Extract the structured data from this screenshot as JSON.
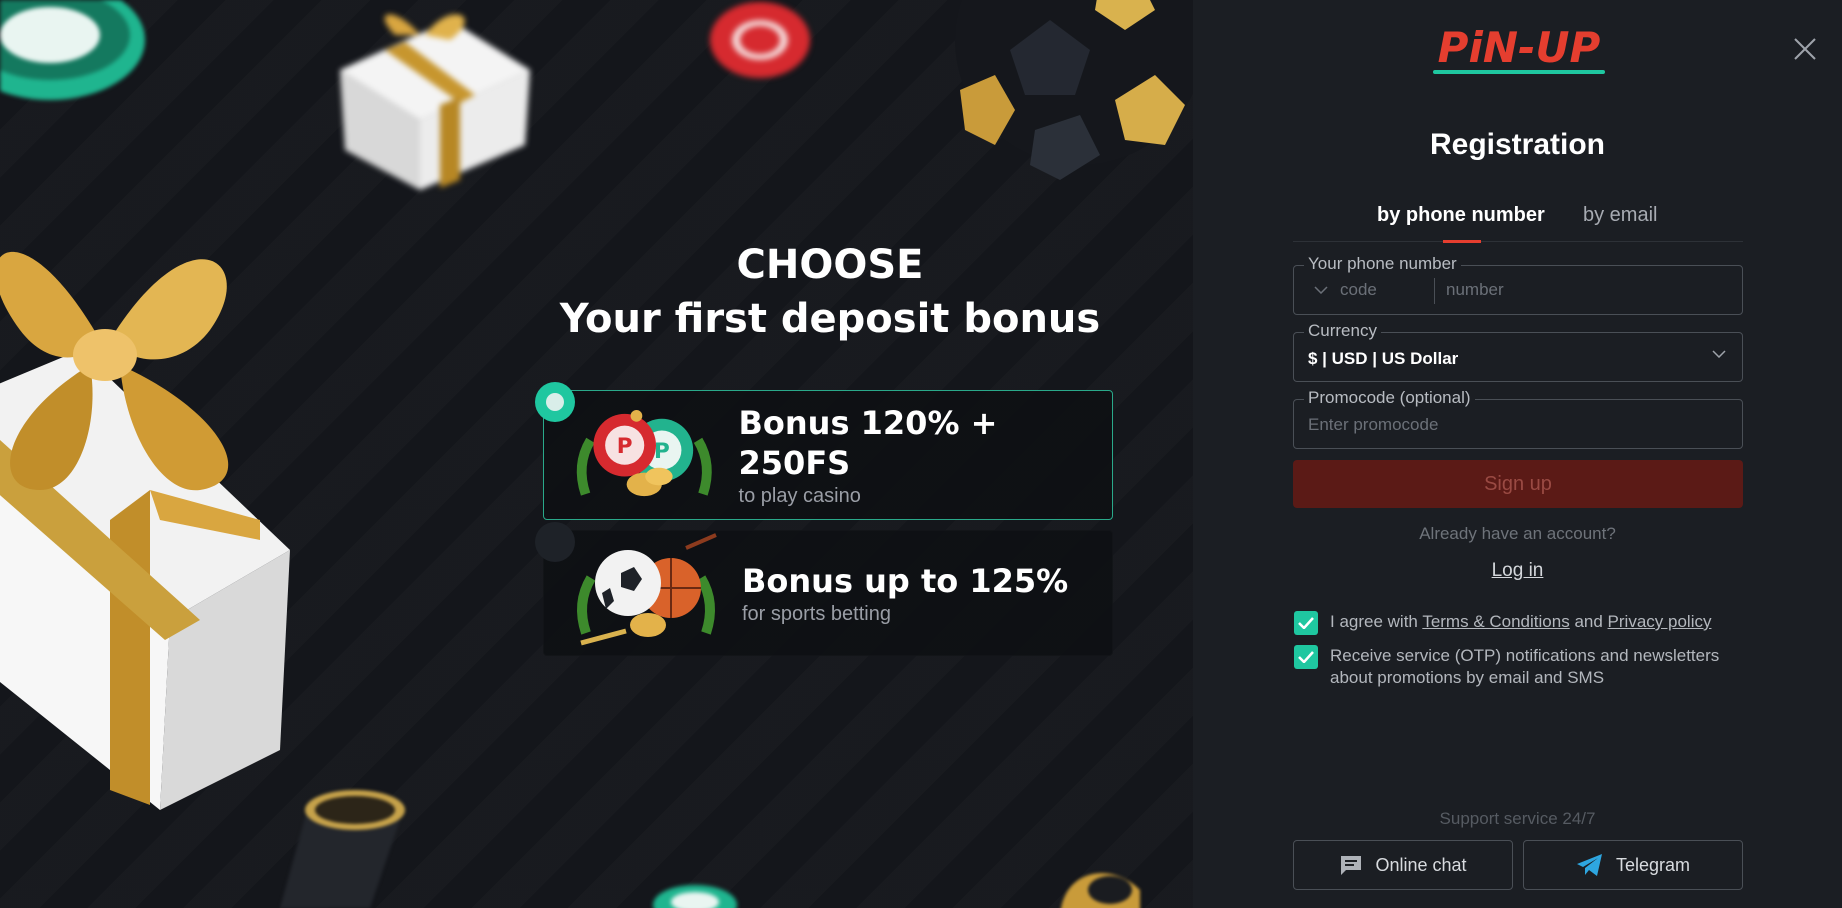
{
  "promo": {
    "heading_line1": "CHOOSE",
    "heading_line2": "Your first deposit bonus",
    "bonuses": [
      {
        "title": "Bonus 120% + 250FS",
        "subtitle": "to play casino",
        "selected": true
      },
      {
        "title": "Bonus up to 125%",
        "subtitle": "for sports betting",
        "selected": false
      }
    ]
  },
  "panel": {
    "logo_text": "PiN-UP",
    "title": "Registration",
    "tabs": [
      {
        "label": "by phone number",
        "active": true
      },
      {
        "label": "by email",
        "active": false
      }
    ],
    "phone": {
      "label": "Your phone number",
      "code_placeholder": "code",
      "number_placeholder": "number"
    },
    "currency": {
      "label": "Currency",
      "value": "$ | USD | US Dollar"
    },
    "promocode": {
      "label": "Promocode (optional)",
      "placeholder": "Enter promocode"
    },
    "signup_label": "Sign up",
    "already_text": "Already have an account?",
    "login_label": "Log in",
    "agree": {
      "prefix": "I agree with",
      "terms": "Terms & Conditions",
      "and": "and",
      "privacy": "Privacy policy",
      "checked": true
    },
    "newsletter": {
      "text": "Receive service (OTP) notifications and newsletters about promotions by email and SMS",
      "checked": true
    },
    "support_text": "Support service 24/7",
    "online_chat_label": "Online chat",
    "telegram_label": "Telegram"
  },
  "colors": {
    "accent_teal": "#1fc7a0",
    "brand_red": "#e53e2f",
    "signup_disabled": "#5b1a16",
    "panel_bg": "#1b1e23"
  },
  "icons": [
    "close-icon",
    "chevron-down-icon",
    "check-icon",
    "chat-icon",
    "telegram-icon"
  ]
}
